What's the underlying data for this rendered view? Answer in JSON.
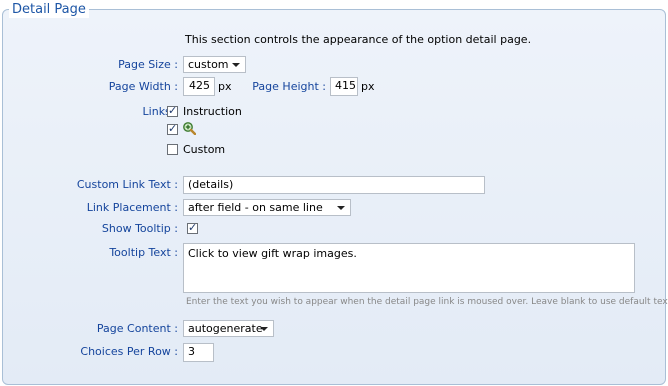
{
  "panel": {
    "title": "Detail Page"
  },
  "intro": "This section controls the appearance of the option detail page.",
  "page_size": {
    "label": "Page Size :",
    "value": "custom"
  },
  "page_width": {
    "label": "Page Width :",
    "value": "425",
    "unit": "px"
  },
  "page_height": {
    "label": "Page Height :",
    "value": "415",
    "unit": "px"
  },
  "links": {
    "label": "Links :",
    "options": [
      {
        "label": "Instruction",
        "checked": true
      },
      {
        "label": "",
        "icon": "magnifier-plus-icon",
        "checked": true
      },
      {
        "label": "Custom",
        "checked": false
      }
    ]
  },
  "custom_link_text": {
    "label": "Custom Link Text :",
    "value": "(details)"
  },
  "link_placement": {
    "label": "Link Placement :",
    "value": "after field - on same line"
  },
  "show_tooltip": {
    "label": "Show Tooltip :",
    "checked": true
  },
  "tooltip_text": {
    "label": "Tooltip Text :",
    "value": "Click to view gift wrap images.",
    "help": "Enter the text you wish to appear when the detail page link is moused over. Leave blank to use default text."
  },
  "page_content": {
    "label": "Page Content :",
    "value": "autogenerate"
  },
  "choices_per_row": {
    "label": "Choices Per Row :",
    "value": "3"
  }
}
